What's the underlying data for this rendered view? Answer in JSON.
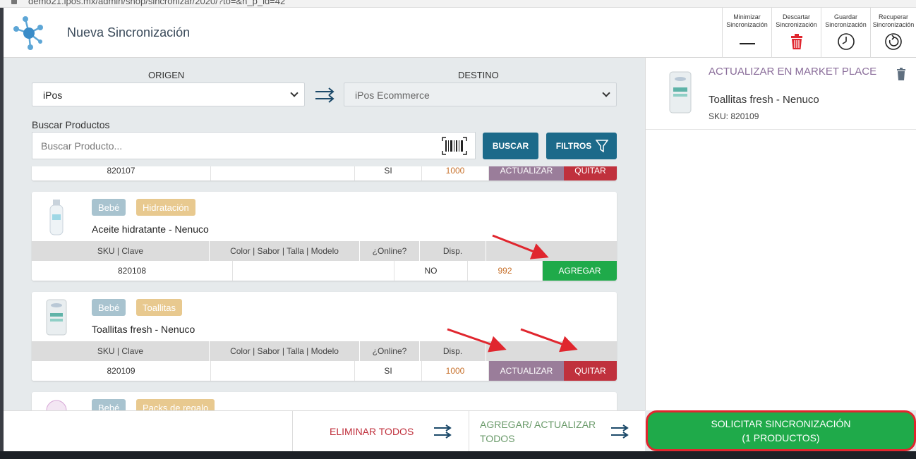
{
  "browser": {
    "url": "demo21.ipos.mx/admin/shop/sincronizar/2020/?to=&n_p_id=42"
  },
  "header": {
    "title": "Nueva Sincronización",
    "buttons": [
      {
        "line1": "Minimizar",
        "line2": "Sincronización",
        "icon": "minimize-icon"
      },
      {
        "line1": "Descartar",
        "line2": "Sincronización",
        "icon": "trash-icon"
      },
      {
        "line1": "Guardar",
        "line2": "Sincronización",
        "icon": "clock-icon"
      },
      {
        "line1": "Recuperar",
        "line2": "Sincronización",
        "icon": "restore-icon"
      }
    ]
  },
  "form": {
    "origin_label": "ORIGEN",
    "origin_value": "iPos",
    "dest_label": "DESTINO",
    "dest_value": "iPos Ecommerce",
    "search_label": "Buscar Productos",
    "search_placeholder": "Buscar Producto...",
    "search_button": "BUSCAR",
    "filters_button": "FILTROS"
  },
  "table_headers": [
    "SKU | Clave",
    "Color | Sabor | Talla | Modelo",
    "¿Online?",
    "Disp."
  ],
  "products": [
    {
      "sku": "820107",
      "online": "SI",
      "disp": "1000",
      "actions": [
        "ACTUALIZAR",
        "QUITAR"
      ]
    },
    {
      "tags": [
        "Bebé",
        "Hidratación"
      ],
      "name": "Aceite hidratante - Nenuco",
      "sku": "820108",
      "online": "NO",
      "disp": "992",
      "actions": [
        "AGREGAR"
      ]
    },
    {
      "tags": [
        "Bebé",
        "Toallitas"
      ],
      "name": "Toallitas fresh - Nenuco",
      "sku": "820109",
      "online": "SI",
      "disp": "1000",
      "actions": [
        "ACTUALIZAR",
        "QUITAR"
      ]
    },
    {
      "tags": [
        "Bebé",
        "Packs de regalo"
      ]
    }
  ],
  "right_panel": {
    "item": {
      "action": "ACTUALIZAR EN MARKET PLACE",
      "name": "Toallitas fresh - Nenuco",
      "sku": "SKU: 820109"
    }
  },
  "footer": {
    "delete_all": "ELIMINAR TODOS",
    "add_update_all_1": "AGREGAR/ ACTUALIZAR",
    "add_update_all_2": "TODOS",
    "sync_line1": "SOLICITAR SINCRONIZACIÓN",
    "sync_line2": "(1 PRODUCTOS)"
  },
  "colors": {
    "primary": "#1c6a8a",
    "update": "#9a7d9a",
    "remove": "#c0313d",
    "add": "#1faa4a",
    "annotation": "#e0262e"
  }
}
